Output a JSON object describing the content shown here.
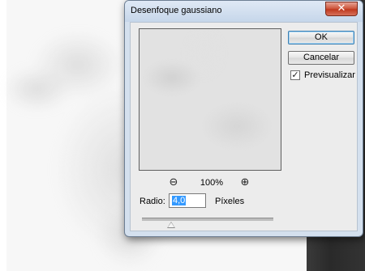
{
  "dialog": {
    "title": "Desenfoque gaussiano",
    "close_glyph": "✕",
    "buttons": {
      "ok_label": "OK",
      "cancel_label": "Cancelar"
    },
    "preview_checkbox": {
      "label": "Previsualizar",
      "checked": true,
      "check_glyph": "✓"
    },
    "zoom": {
      "level": "100%",
      "zoom_out_icon": "zoom-out-icon",
      "zoom_in_icon": "zoom-in-icon",
      "zoom_out_glyph": "⊖",
      "zoom_in_glyph": "⊕"
    },
    "radius": {
      "label": "Radio:",
      "value": "4,0",
      "unit": "Píxeles",
      "slider_fraction": 0.22
    }
  },
  "colors": {
    "title_bar": "#c6d6ea",
    "close_button": "#c0391f",
    "selection": "#3399ff"
  }
}
